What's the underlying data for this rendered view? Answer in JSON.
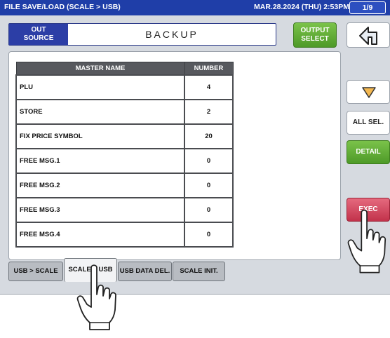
{
  "titlebar": {
    "title": "FILE SAVE/LOAD (SCALE > USB)",
    "datetime": "MAR.28.2024 (THU)  2:53PM",
    "page": "1/9"
  },
  "header": {
    "out_source": "OUT\nSOURCE",
    "out_source_line1": "OUT",
    "out_source_line2": "SOURCE",
    "mode": "BACKUP"
  },
  "buttons": {
    "output_select_line1": "OUTPUT",
    "output_select_line2": "SELECT",
    "all_sel": "ALL SEL.",
    "detail": "DETAIL",
    "exec": "EXEC"
  },
  "table": {
    "headers": [
      "MASTER NAME",
      "NUMBER"
    ],
    "rows": [
      {
        "name": "PLU",
        "number": "4"
      },
      {
        "name": "STORE",
        "number": "2"
      },
      {
        "name": "FIX PRICE SYMBOL",
        "number": "20"
      },
      {
        "name": "FREE MSG.1",
        "number": "0"
      },
      {
        "name": "FREE MSG.2",
        "number": "0"
      },
      {
        "name": "FREE MSG.3",
        "number": "0"
      },
      {
        "name": "FREE MSG.4",
        "number": "0"
      }
    ]
  },
  "tabs": [
    {
      "label": "USB > SCALE"
    },
    {
      "label": "SCALE > USB"
    },
    {
      "label": "USB DATA DEL."
    },
    {
      "label": "SCALE INIT."
    }
  ],
  "colors": {
    "titlebar": "#1f3ea8",
    "accent_blue": "#2c3ea6",
    "green": "#5ea832",
    "exec_red": "#d04a60"
  },
  "icons": {
    "back": "return-arrow-icon",
    "down": "triangle-down-icon",
    "hand": "pointing-hand-icon"
  }
}
